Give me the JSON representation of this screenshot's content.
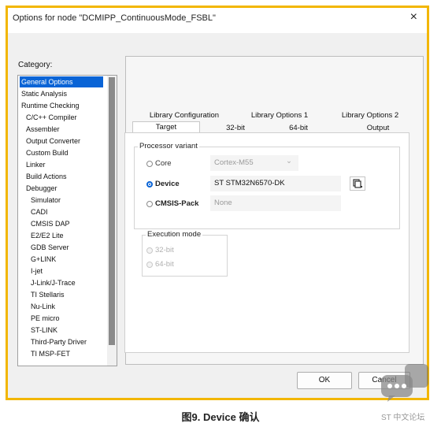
{
  "window": {
    "title": "Options for node \"DCMIPP_ContinuousMode_FSBL\"",
    "close_label": "×"
  },
  "category": {
    "label": "Category:",
    "items": [
      "General Options",
      "Static Analysis",
      "Runtime Checking",
      "C/C++ Compiler",
      "Assembler",
      "Output Converter",
      "Custom Build",
      "Linker",
      "Build Actions",
      "Debugger",
      "Simulator",
      "CADI",
      "CMSIS DAP",
      "E2/E2 Lite",
      "GDB Server",
      "G+LINK",
      "I-jet",
      "J-Link/J-Trace",
      "TI Stellaris",
      "Nu-Link",
      "PE micro",
      "ST-LINK",
      "Third-Party Driver",
      "TI MSP-FET"
    ],
    "selected": "General Options"
  },
  "tabs_row1": [
    "Library Configuration",
    "Library Options 1",
    "Library Options 2"
  ],
  "tabs_row2": [
    "Target",
    "32-bit",
    "64-bit",
    "Output"
  ],
  "active_tab": "Target",
  "processor_variant": {
    "label": "Processor variant",
    "core": {
      "label": "Core",
      "value": "Cortex-M55",
      "arrow": "⌄"
    },
    "device": {
      "label": "Device",
      "value": "ST STM32N6570-DK",
      "selected": true,
      "icon": "device-select-icon"
    },
    "cmsis_pack": {
      "label": "CMSIS-Pack",
      "value": "None"
    }
  },
  "execution_mode": {
    "label": "Execution mode",
    "options": [
      "32-bit",
      "64-bit"
    ]
  },
  "buttons": {
    "ok": "OK",
    "cancel": "Cancel"
  },
  "caption": "图9. Device 确认",
  "watermark": "ST 中文论坛",
  "colors": {
    "border": "#f2b600",
    "selection": "#0a64d6"
  }
}
